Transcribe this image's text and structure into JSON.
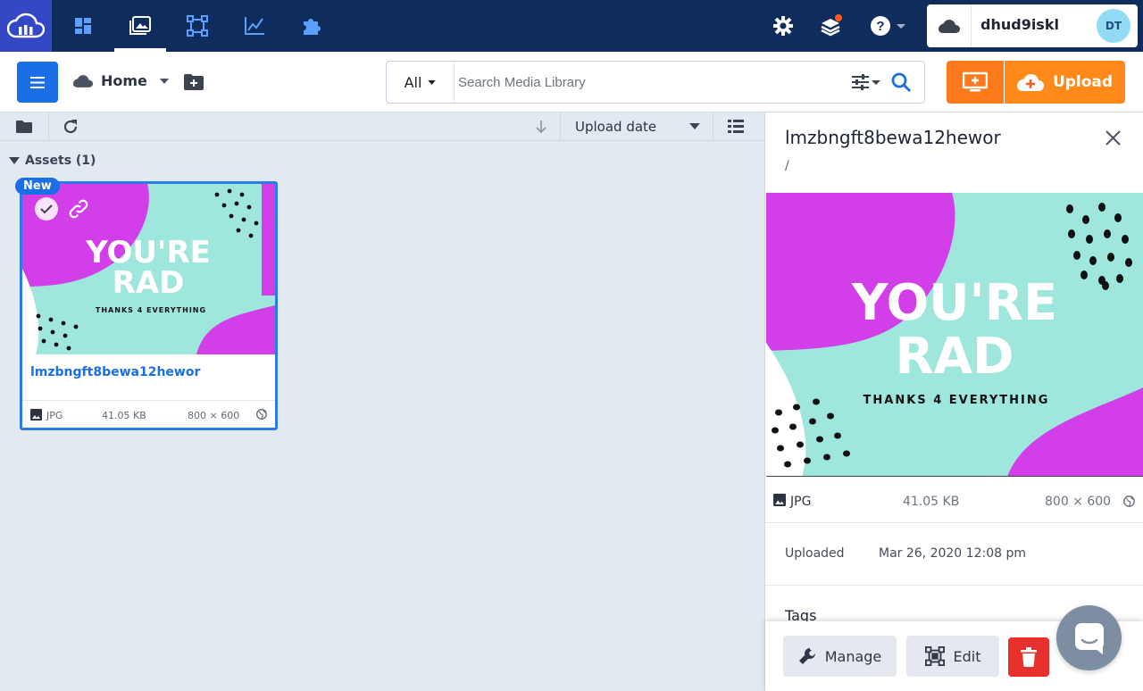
{
  "app": {
    "name": "Cloudinary Media Library"
  },
  "nav": {
    "items": [
      "dashboard",
      "media-library",
      "transformations",
      "reports",
      "add-ons"
    ],
    "active": "media-library"
  },
  "account": {
    "cloud_name": "dhud9iskl",
    "avatar_initials": "DT"
  },
  "toolbar": {
    "folder": "Home",
    "search_scope": "All",
    "search_placeholder": "Search Media Library",
    "upload_label": "Upload"
  },
  "listing": {
    "sort_label": "Upload date",
    "section_label": "Assets (1)"
  },
  "asset": {
    "badge": "New",
    "public_id": "lmzbngft8bewa12hewor",
    "format": "JPG",
    "size": "41.05 KB",
    "dimensions": "800 × 600",
    "image_text": {
      "line1": "YOU'RE",
      "line2": "RAD",
      "line3": "THANKS 4 EVERYTHING"
    }
  },
  "details": {
    "title": "lmzbngft8bewa12hewor",
    "path": "/",
    "format": "JPG",
    "size": "41.05 KB",
    "dimensions": "800 × 600",
    "uploaded_label": "Uploaded",
    "uploaded_value": "Mar 26, 2020 12:08 pm",
    "tags_label": "Tags"
  },
  "actions": {
    "manage": "Manage",
    "edit": "Edit"
  },
  "colors": {
    "nav_bg": "#0e2d5c",
    "accent_blue": "#1a6ee6",
    "upload_orange": "#ff8a1a",
    "delete_red": "#e8302c",
    "magenta": "#d23ee8",
    "mint": "#9fe6dc"
  }
}
